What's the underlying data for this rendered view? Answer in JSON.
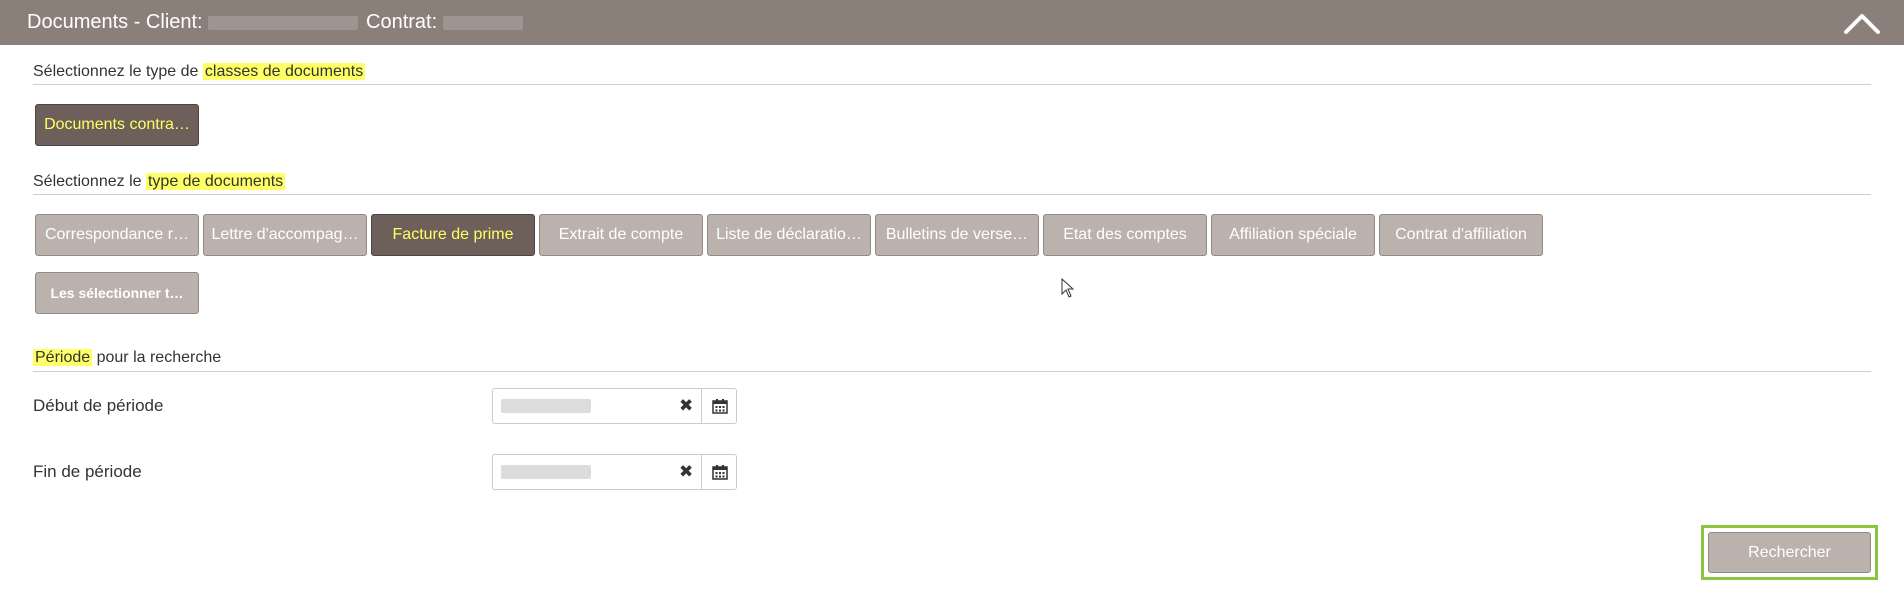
{
  "header": {
    "title": "Documents - Client:",
    "contrat_label": "Contrat:"
  },
  "classes_section": {
    "label_prefix": "Sélectionnez le type de",
    "label_highlight": "classes de documents",
    "buttons": [
      {
        "label": "Documents contra…",
        "selected": true
      }
    ]
  },
  "types_section": {
    "label_prefix": "Sélectionnez le",
    "label_highlight": "type de documents",
    "buttons": [
      {
        "label": "Correspondance r…",
        "selected": false
      },
      {
        "label": "Lettre d'accompag…",
        "selected": false
      },
      {
        "label": "Facture de prime",
        "selected": true
      },
      {
        "label": "Extrait de compte",
        "selected": false
      },
      {
        "label": "Liste de déclaratio…",
        "selected": false
      },
      {
        "label": "Bulletins de verse…",
        "selected": false
      },
      {
        "label": "Etat des comptes",
        "selected": false
      },
      {
        "label": "Affiliation spéciale",
        "selected": false
      },
      {
        "label": "Contrat d'affiliation",
        "selected": false
      }
    ],
    "select_all_label": "Les sélectionner t…"
  },
  "period_section": {
    "label_highlight": "Période",
    "label_suffix": "pour la recherche",
    "start_label": "Début de période",
    "end_label": "Fin de période",
    "clear_glyph": "✖"
  },
  "search_button_label": "Rechercher",
  "colors": {
    "header_bg": "#8b7f7a",
    "button_bg": "#bbb2ae",
    "selected_bg": "#6d605a",
    "highlight": "#ffff66",
    "focus_border": "#8cc63f"
  }
}
